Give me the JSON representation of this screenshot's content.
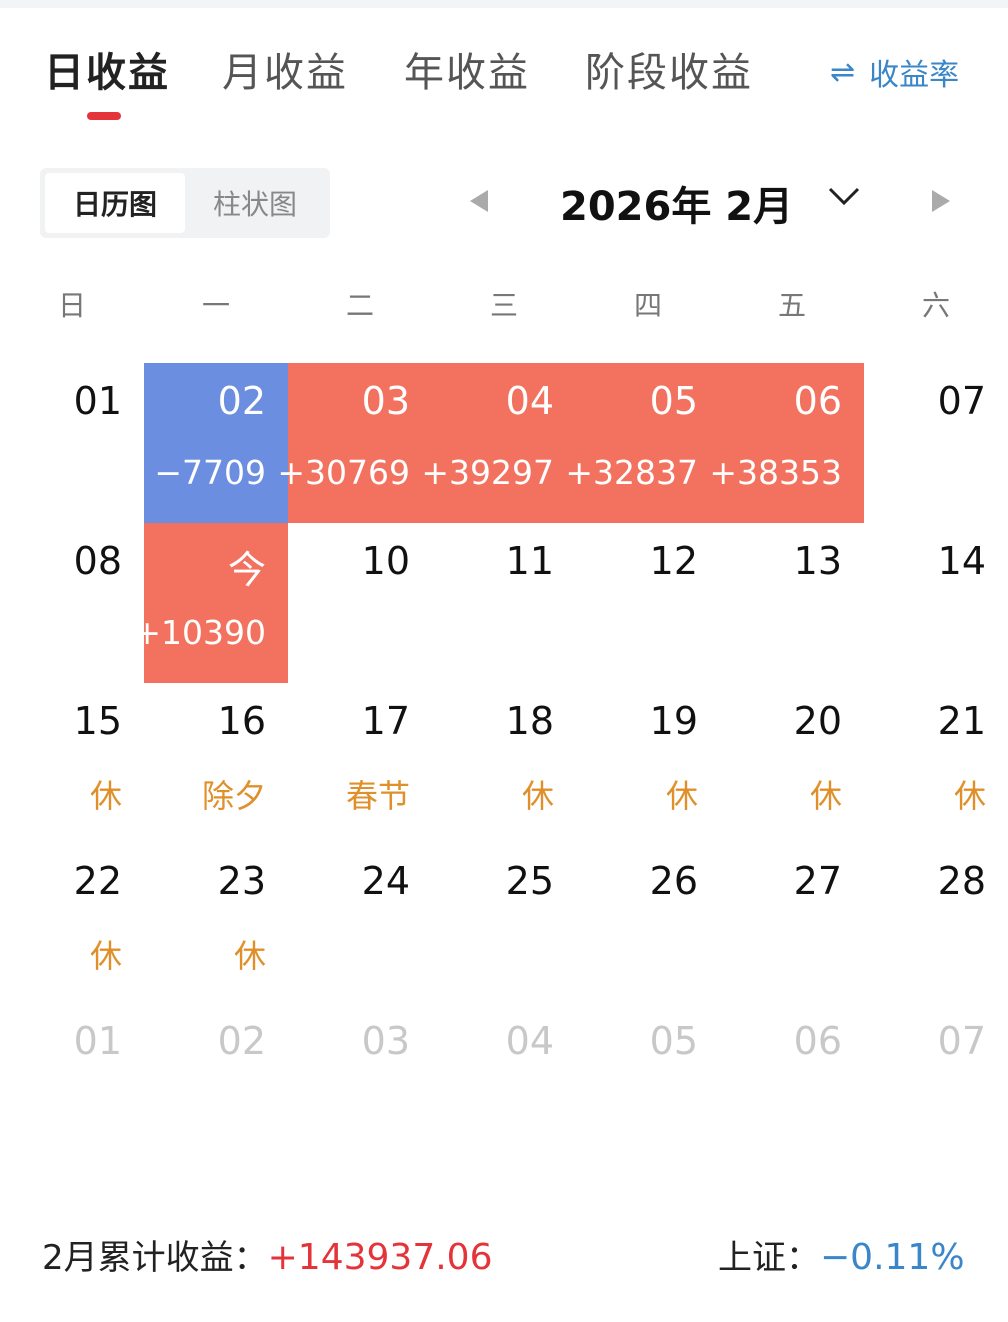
{
  "tabs": [
    {
      "label": "日收益",
      "active": true
    },
    {
      "label": "月收益",
      "active": false
    },
    {
      "label": "年收益",
      "active": false
    },
    {
      "label": "阶段收益",
      "active": false
    }
  ],
  "rate_toggle": {
    "icon": "swap-arrows-icon",
    "label": "收益率",
    "color": "#3a86c8"
  },
  "view_switch": {
    "calendar_label": "日历图",
    "bar_label": "柱状图",
    "active": "calendar"
  },
  "month_nav": {
    "title": "2026年 2月"
  },
  "weekdays": [
    "日",
    "一",
    "二",
    "三",
    "四",
    "五",
    "六"
  ],
  "colors": {
    "gain": "#f2725f",
    "loss": "#6b8ee0",
    "holiday": "#e0902a",
    "accent_red": "#e5333a"
  },
  "calendar": [
    [
      {
        "day": "01"
      },
      {
        "day": "02",
        "value": "−7709",
        "status": "loss"
      },
      {
        "day": "03",
        "value": "+30769",
        "status": "gain"
      },
      {
        "day": "04",
        "value": "+39297",
        "status": "gain"
      },
      {
        "day": "05",
        "value": "+32837",
        "status": "gain"
      },
      {
        "day": "06",
        "value": "+38353",
        "status": "gain"
      },
      {
        "day": "07"
      }
    ],
    [
      {
        "day": "08"
      },
      {
        "day": "今",
        "value": "+10390",
        "status": "gain"
      },
      {
        "day": "10"
      },
      {
        "day": "11"
      },
      {
        "day": "12"
      },
      {
        "day": "13"
      },
      {
        "day": "14"
      }
    ],
    [
      {
        "day": "15",
        "tag": "休"
      },
      {
        "day": "16",
        "tag": "除夕"
      },
      {
        "day": "17",
        "tag": "春节"
      },
      {
        "day": "18",
        "tag": "休"
      },
      {
        "day": "19",
        "tag": "休"
      },
      {
        "day": "20",
        "tag": "休"
      },
      {
        "day": "21",
        "tag": "休"
      }
    ],
    [
      {
        "day": "22",
        "tag": "休"
      },
      {
        "day": "23",
        "tag": "休"
      },
      {
        "day": "24"
      },
      {
        "day": "25"
      },
      {
        "day": "26"
      },
      {
        "day": "27"
      },
      {
        "day": "28"
      }
    ],
    [
      {
        "day": "01",
        "status": "next-month"
      },
      {
        "day": "02",
        "status": "next-month"
      },
      {
        "day": "03",
        "status": "next-month"
      },
      {
        "day": "04",
        "status": "next-month"
      },
      {
        "day": "05",
        "status": "next-month"
      },
      {
        "day": "06",
        "status": "next-month"
      },
      {
        "day": "07",
        "status": "next-month"
      }
    ]
  ],
  "footer": {
    "monthly_label": "2月累计收益：",
    "monthly_value": "+143937.06",
    "index_label": "上证：",
    "index_value": "−0.11%"
  }
}
